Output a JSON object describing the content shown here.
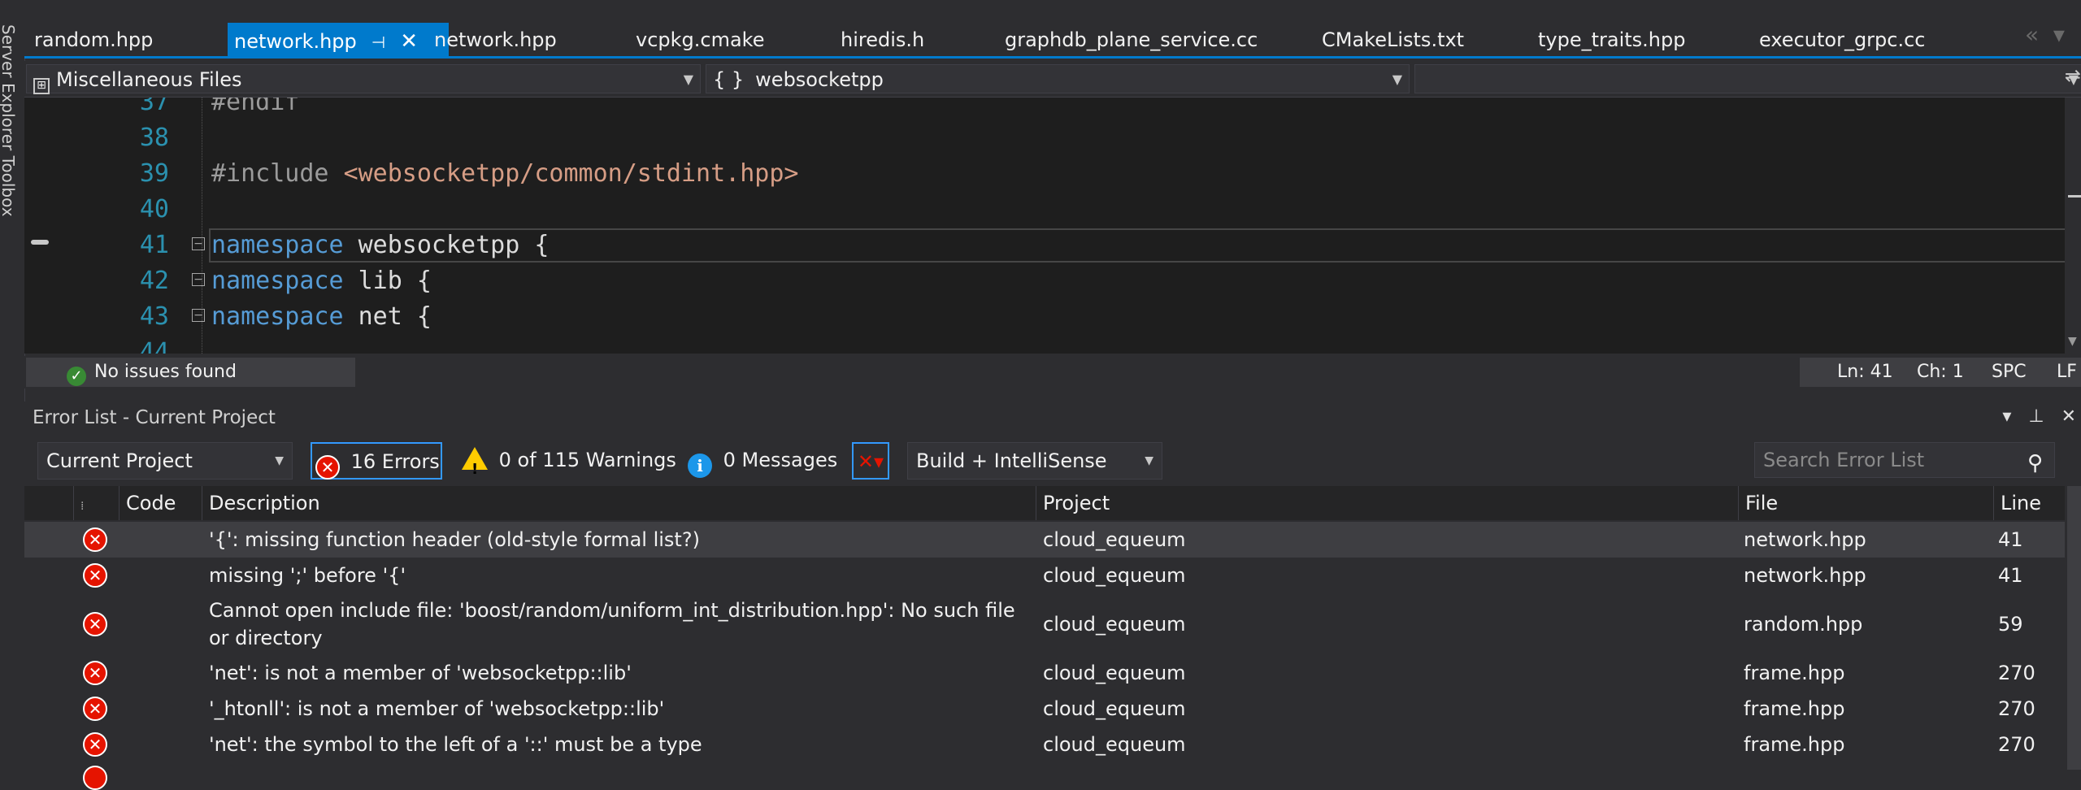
{
  "left_strip": {
    "label": "Server Explorer   Toolbox"
  },
  "tabs": [
    {
      "label": "random.hpp"
    },
    {
      "label": "network.hpp",
      "active": true
    },
    {
      "label": "network.hpp"
    },
    {
      "label": "vcpkg.cmake"
    },
    {
      "label": "hiredis.h"
    },
    {
      "label": "graphdb_plane_service.cc"
    },
    {
      "label": "CMakeLists.txt"
    },
    {
      "label": "type_traits.hpp"
    },
    {
      "label": "executor_grpc.cc"
    }
  ],
  "navbar": {
    "project": "Miscellaneous Files",
    "scope": "websocketpp",
    "member": ""
  },
  "editor": {
    "lines": [
      {
        "num": "37",
        "code": "#endif"
      },
      {
        "num": "38",
        "code": ""
      },
      {
        "num": "39",
        "pp": "#include ",
        "str": "<websocketpp/common/stdint.hpp>"
      },
      {
        "num": "40",
        "code": ""
      },
      {
        "num": "41",
        "kw": "namespace",
        "rest": " websocketpp {"
      },
      {
        "num": "42",
        "kw": "namespace",
        "rest": " lib {"
      },
      {
        "num": "43",
        "kw": "namespace",
        "rest": " net {"
      },
      {
        "num": "44",
        "code": ""
      }
    ]
  },
  "status": {
    "issues": "No issues found",
    "ln": "Ln: 41",
    "ch": "Ch: 1",
    "spc": "SPC",
    "lf": "LF"
  },
  "error_list": {
    "title": "Error List - Current Project",
    "scope": "Current Project",
    "errors": "16 Errors",
    "warnings": "0 of 115 Warnings",
    "messages": "0 Messages",
    "build_filter": "Build + IntelliSense",
    "search_placeholder": "Search Error List",
    "columns": {
      "code": "Code",
      "description": "Description",
      "project": "Project",
      "file": "File",
      "line": "Line"
    },
    "rows": [
      {
        "description": "'{': missing function header (old-style formal list?)",
        "project": "cloud_equeum",
        "file": "network.hpp",
        "line": "41"
      },
      {
        "description": "missing ';' before '{'",
        "project": "cloud_equeum",
        "file": "network.hpp",
        "line": "41"
      },
      {
        "description": "Cannot open include file: 'boost/random/uniform_int_distribution.hpp': No such file or directory",
        "project": "cloud_equeum",
        "file": "random.hpp",
        "line": "59"
      },
      {
        "description": "'net': is not a member of 'websocketpp::lib'",
        "project": "cloud_equeum",
        "file": "frame.hpp",
        "line": "270"
      },
      {
        "description": "'_htonll': is not a member of 'websocketpp::lib'",
        "project": "cloud_equeum",
        "file": "frame.hpp",
        "line": "270"
      },
      {
        "description": "'net': the symbol to the left of a '::' must be a type",
        "project": "cloud_equeum",
        "file": "frame.hpp",
        "line": "270"
      }
    ]
  },
  "colors": {
    "accent": "#007acc",
    "error": "#e51400",
    "warning": "#ffcc00",
    "info": "#1c97ea",
    "ok": "#388a34"
  }
}
